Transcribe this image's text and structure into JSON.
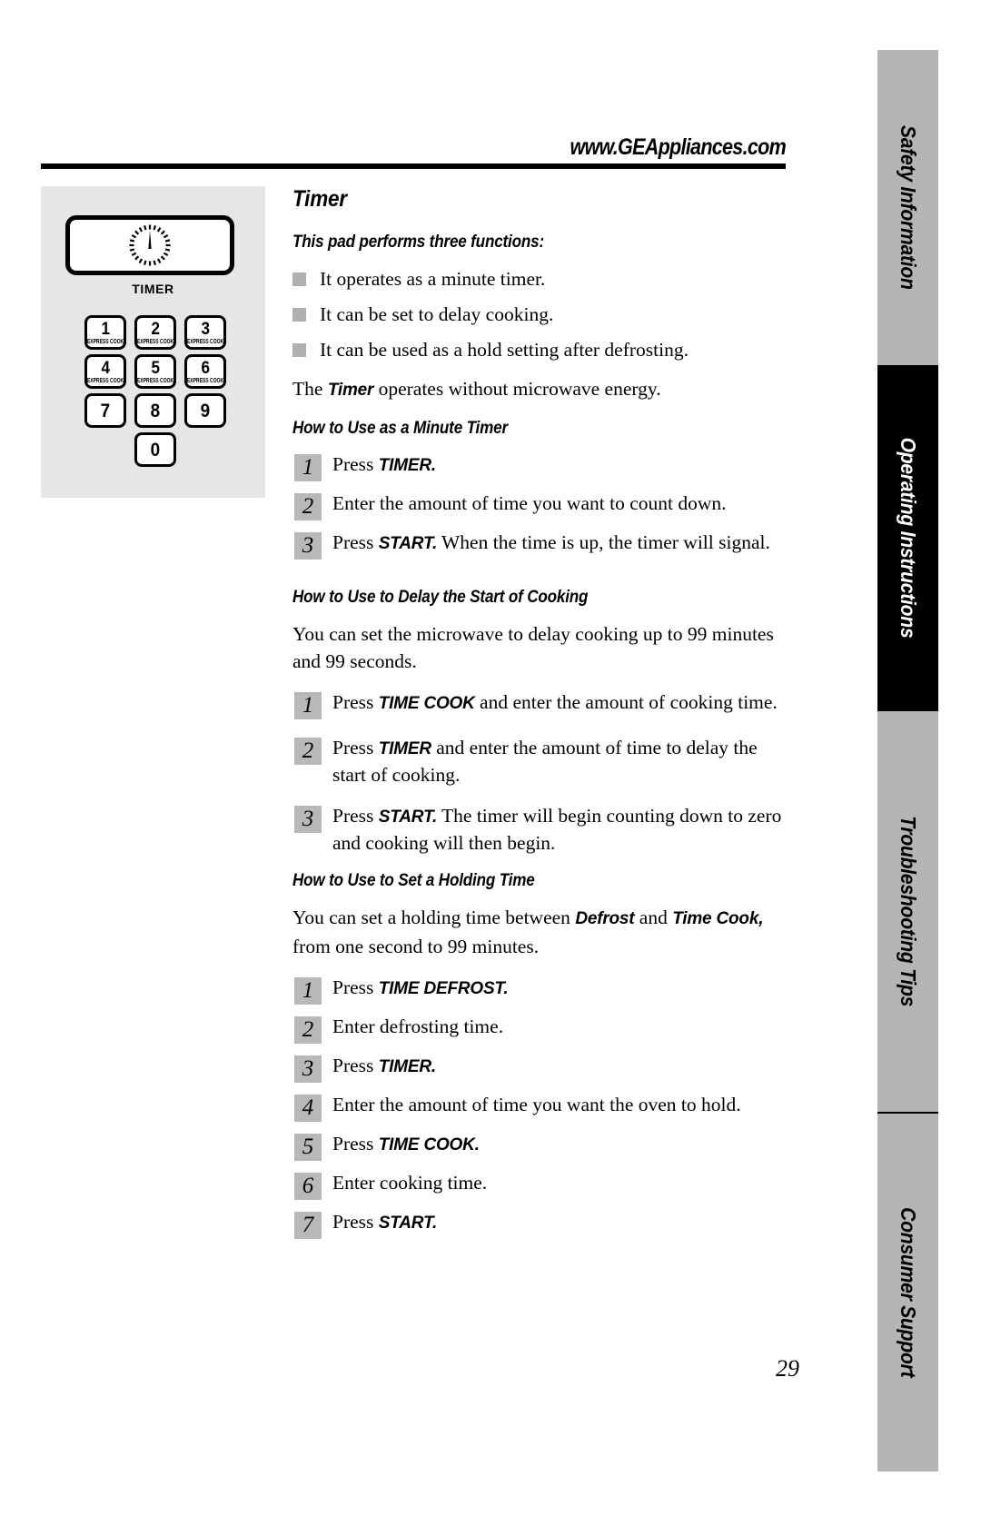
{
  "header": {
    "url": "www.GEAppliances.com"
  },
  "control_panel": {
    "timer_key_label": "TIMER",
    "timer_key_icon": "timer-dial-icon",
    "keypad": [
      {
        "number": "1",
        "sub": "EXPRESS COOK"
      },
      {
        "number": "2",
        "sub": "EXPRESS COOK"
      },
      {
        "number": "3",
        "sub": "EXPRESS COOK"
      },
      {
        "number": "4",
        "sub": "EXPRESS COOK"
      },
      {
        "number": "5",
        "sub": "EXPRESS COOK"
      },
      {
        "number": "6",
        "sub": "EXPRESS COOK"
      },
      {
        "number": "7",
        "sub": ""
      },
      {
        "number": "8",
        "sub": ""
      },
      {
        "number": "9",
        "sub": ""
      },
      {
        "number": "0",
        "sub": ""
      }
    ]
  },
  "content": {
    "title": "Timer",
    "intro_heading": "This pad performs three functions:",
    "bullets": [
      "It operates as a minute timer.",
      "It can be set to delay cooking.",
      "It can be used as a hold setting after defrosting."
    ],
    "intro_note_pre": "The ",
    "intro_note_bold": "Timer",
    "intro_note_post": " operates without microwave energy.",
    "sections": [
      {
        "heading": "How to Use as a Minute Timer",
        "steps": [
          {
            "n": "1",
            "pre": "Press ",
            "bold": "TIMER.",
            "post": ""
          },
          {
            "n": "2",
            "pre": "Enter the amount of time you want to count down.",
            "bold": "",
            "post": ""
          },
          {
            "n": "3",
            "pre": "Press ",
            "bold": "START.",
            "post": " When the time is up, the timer will signal."
          }
        ]
      },
      {
        "heading": "How to Use to Delay the Start of Cooking",
        "intro": "You can set the microwave to delay cooking up to 99 minutes and 99 seconds.",
        "steps": [
          {
            "n": "1",
            "pre": "Press ",
            "bold": "TIME COOK",
            "post": " and enter the amount of cooking time."
          },
          {
            "n": "2",
            "pre": "Press ",
            "bold": "TIMER",
            "post": " and enter the amount of time to delay the start of cooking."
          },
          {
            "n": "3",
            "pre": "Press ",
            "bold": "START.",
            "post": " The timer will begin counting down to zero and cooking will then begin."
          }
        ]
      },
      {
        "heading": "How to Use to Set a Holding Time",
        "intro_pre": "You can set a holding time between ",
        "intro_bold1": "Defrost",
        "intro_mid": " and ",
        "intro_bold2": "Time Cook,",
        "intro_post": " from one second to 99 minutes.",
        "steps": [
          {
            "n": "1",
            "pre": "Press ",
            "bold": "TIME DEFROST.",
            "post": ""
          },
          {
            "n": "2",
            "pre": "Enter defrosting time.",
            "bold": "",
            "post": ""
          },
          {
            "n": "3",
            "pre": "Press ",
            "bold": "TIMER.",
            "post": ""
          },
          {
            "n": "4",
            "pre": "Enter the amount of time you want the oven to hold.",
            "bold": "",
            "post": ""
          },
          {
            "n": "5",
            "pre": "Press ",
            "bold": "TIME COOK.",
            "post": ""
          },
          {
            "n": "6",
            "pre": "Enter cooking time.",
            "bold": "",
            "post": ""
          },
          {
            "n": "7",
            "pre": "Press ",
            "bold": "START.",
            "post": ""
          }
        ]
      }
    ]
  },
  "tabs": [
    {
      "label": "Safety Information",
      "active": false
    },
    {
      "label": "Operating Instructions",
      "active": true
    },
    {
      "label": "Troubleshooting Tips",
      "active": false
    },
    {
      "label": "Consumer Support",
      "active": false
    }
  ],
  "page_number": "29",
  "colors": {
    "tab_inactive": "#b5b5b5",
    "tab_active": "#000000",
    "panel_bg": "#e6e6e6",
    "step_box": "#b8b8b8",
    "bullet": "#b0b0b0"
  }
}
